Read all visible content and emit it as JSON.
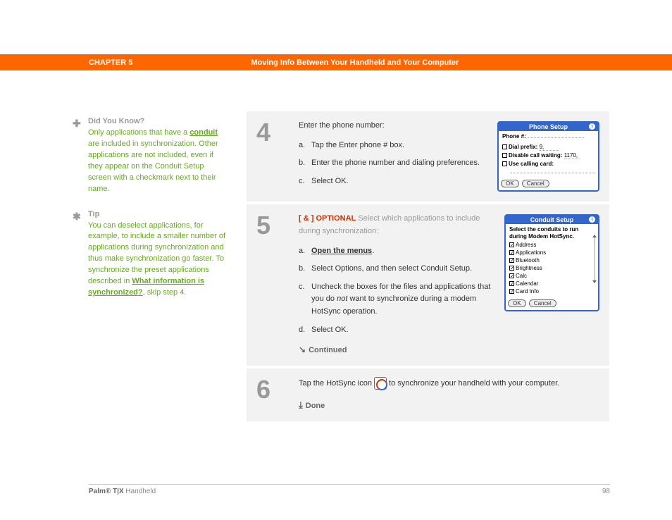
{
  "header": {
    "chapter": "CHAPTER 5",
    "title": "Moving Info Between Your Handheld and Your Computer"
  },
  "sidebar": {
    "didyouknow": {
      "icon": "✚",
      "head": "Did You Know?",
      "pre": "Only applications that have a ",
      "link": "conduit",
      "post": " are included in synchronization. Other applications are not included, even if they appear on the Conduit Setup screen with a checkmark next to their name."
    },
    "tip": {
      "icon": "✱",
      "head": "Tip",
      "pre": "You can deselect applications, for example, to include a smaller number of applications during synchronization and thus make synchronization go faster. To synchronize the preset applications described in ",
      "link": "What information is synchronized?",
      "post": ", skip step 4."
    }
  },
  "steps": {
    "s4": {
      "num": "4",
      "lead": "Enter the phone number:",
      "a": "Tap the Enter phone # box.",
      "b": "Enter the phone number and dialing preferences.",
      "c": "Select OK."
    },
    "s5": {
      "num": "5",
      "tag": "[ & ]  OPTIONAL",
      "desc": "   Select which applications to include during synchronization:",
      "a_link": "Open the menus",
      "a_post": ".",
      "b": "Select Options, and then select Conduit Setup.",
      "c_pre": "Uncheck the boxes for the files and applications that you do ",
      "c_em": "not",
      "c_post": " want to synchronize during a modem HotSync operation.",
      "d": "Select OK.",
      "cont": "Continued"
    },
    "s6": {
      "num": "6",
      "pre": "Tap the HotSync icon ",
      "post": " to synchronize your handheld with your computer.",
      "done": "Done"
    }
  },
  "shots": {
    "phone": {
      "title": "Phone Setup",
      "r1": "Phone #:",
      "r2": "Dial prefix:",
      "r2v": "9,",
      "r3": "Disable call waiting:",
      "r3v": "1170,",
      "r4": "Use calling card:",
      "ok": "OK",
      "cancel": "Cancel"
    },
    "conduit": {
      "title": "Conduit Setup",
      "lead": "Select the conduits to run during Modem HotSync.",
      "items": [
        "Address",
        "Applications",
        "Bluetooth",
        "Brightness",
        "Calc",
        "Calendar",
        "Card Info"
      ],
      "ok": "OK",
      "cancel": "Cancel"
    }
  },
  "footer": {
    "product_bold": "Palm® T|X",
    "product_rest": " Handheld",
    "page": "98"
  }
}
